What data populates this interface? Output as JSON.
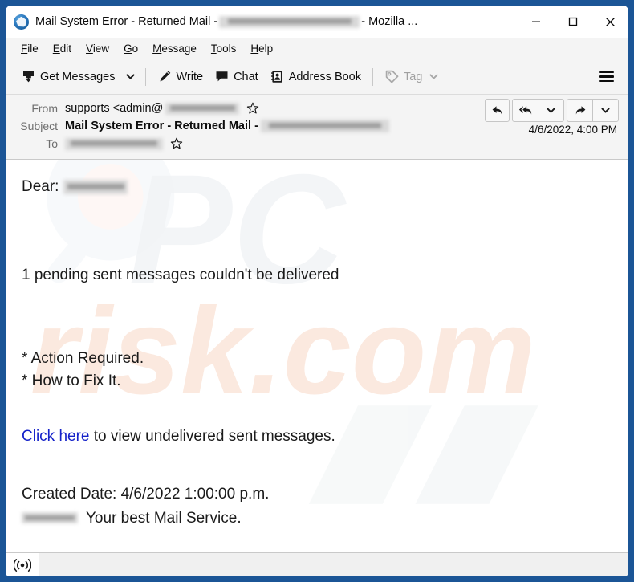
{
  "window": {
    "title_prefix": "Mail System Error - Returned Mail - ",
    "title_suffix": " - Mozilla ...",
    "app_icon": "thunderbird-icon",
    "controls": {
      "minimize": "minimize-icon",
      "maximize": "maximize-icon",
      "close": "close-icon"
    }
  },
  "menu_bar": {
    "items": [
      {
        "label": "File",
        "accesskey": "F"
      },
      {
        "label": "Edit",
        "accesskey": "E"
      },
      {
        "label": "View",
        "accesskey": "V"
      },
      {
        "label": "Go",
        "accesskey": "G"
      },
      {
        "label": "Message",
        "accesskey": "M"
      },
      {
        "label": "Tools",
        "accesskey": "T"
      },
      {
        "label": "Help",
        "accesskey": "H"
      }
    ]
  },
  "toolbar": {
    "get_messages_label": "Get Messages",
    "get_messages_icon": "download-inbox-icon",
    "get_messages_caret": "chevron-down-icon",
    "write_label": "Write",
    "write_icon": "pencil-icon",
    "chat_label": "Chat",
    "chat_icon": "speech-bubble-icon",
    "address_book_label": "Address Book",
    "address_book_icon": "address-book-icon",
    "tag_label": "Tag",
    "tag_icon": "tag-icon",
    "tag_caret": "chevron-down-icon",
    "tag_disabled": true,
    "hamburger_icon": "hamburger-menu-icon"
  },
  "message_header": {
    "from_label": "From",
    "from_value": "supports <admin@",
    "from_redacted": true,
    "subject_label": "Subject",
    "subject_value": "Mail System Error - Returned Mail - ",
    "subject_redacted": true,
    "to_label": "To",
    "to_redacted": true,
    "date": "4/6/2022, 4:00 PM",
    "star_icon": "star-outline-icon",
    "actions": [
      {
        "name": "reply-button",
        "icon": "reply-arrow-icon"
      },
      {
        "name": "reply-all-button",
        "icon": "reply-all-arrow-icon"
      },
      {
        "name": "reply-more-button",
        "icon": "chevron-down-icon"
      },
      {
        "name": "forward-button",
        "icon": "forward-arrow-icon"
      },
      {
        "name": "forward-more-button",
        "icon": "chevron-down-icon"
      }
    ]
  },
  "message_body": {
    "greeting": "Dear:",
    "greeting_redacted": true,
    "pending": "1 pending sent messages couldn't be delivered",
    "bullet_action": "* Action Required.",
    "bullet_fix": "* How to Fix It.",
    "link_text": "Click here",
    "link_tail": " to view undelivered sent messages.",
    "created_date": "Created Date: 4/6/2022 1:00:00 p.m.",
    "signature": "Your best Mail Service.",
    "signature_redacted": true,
    "watermark_text": "PCrisk.com"
  },
  "status_bar": {
    "online_icon": "connection-online-icon",
    "message": ""
  },
  "colors": {
    "window_border": "#1b5596",
    "toolbar_bg": "#f4f4f4",
    "header_bg": "#f4f4f4",
    "body_bg": "#ffffff",
    "link": "#1522c9",
    "disabled_text": "#a0a0a0",
    "label_text": "#6e6e6e"
  }
}
